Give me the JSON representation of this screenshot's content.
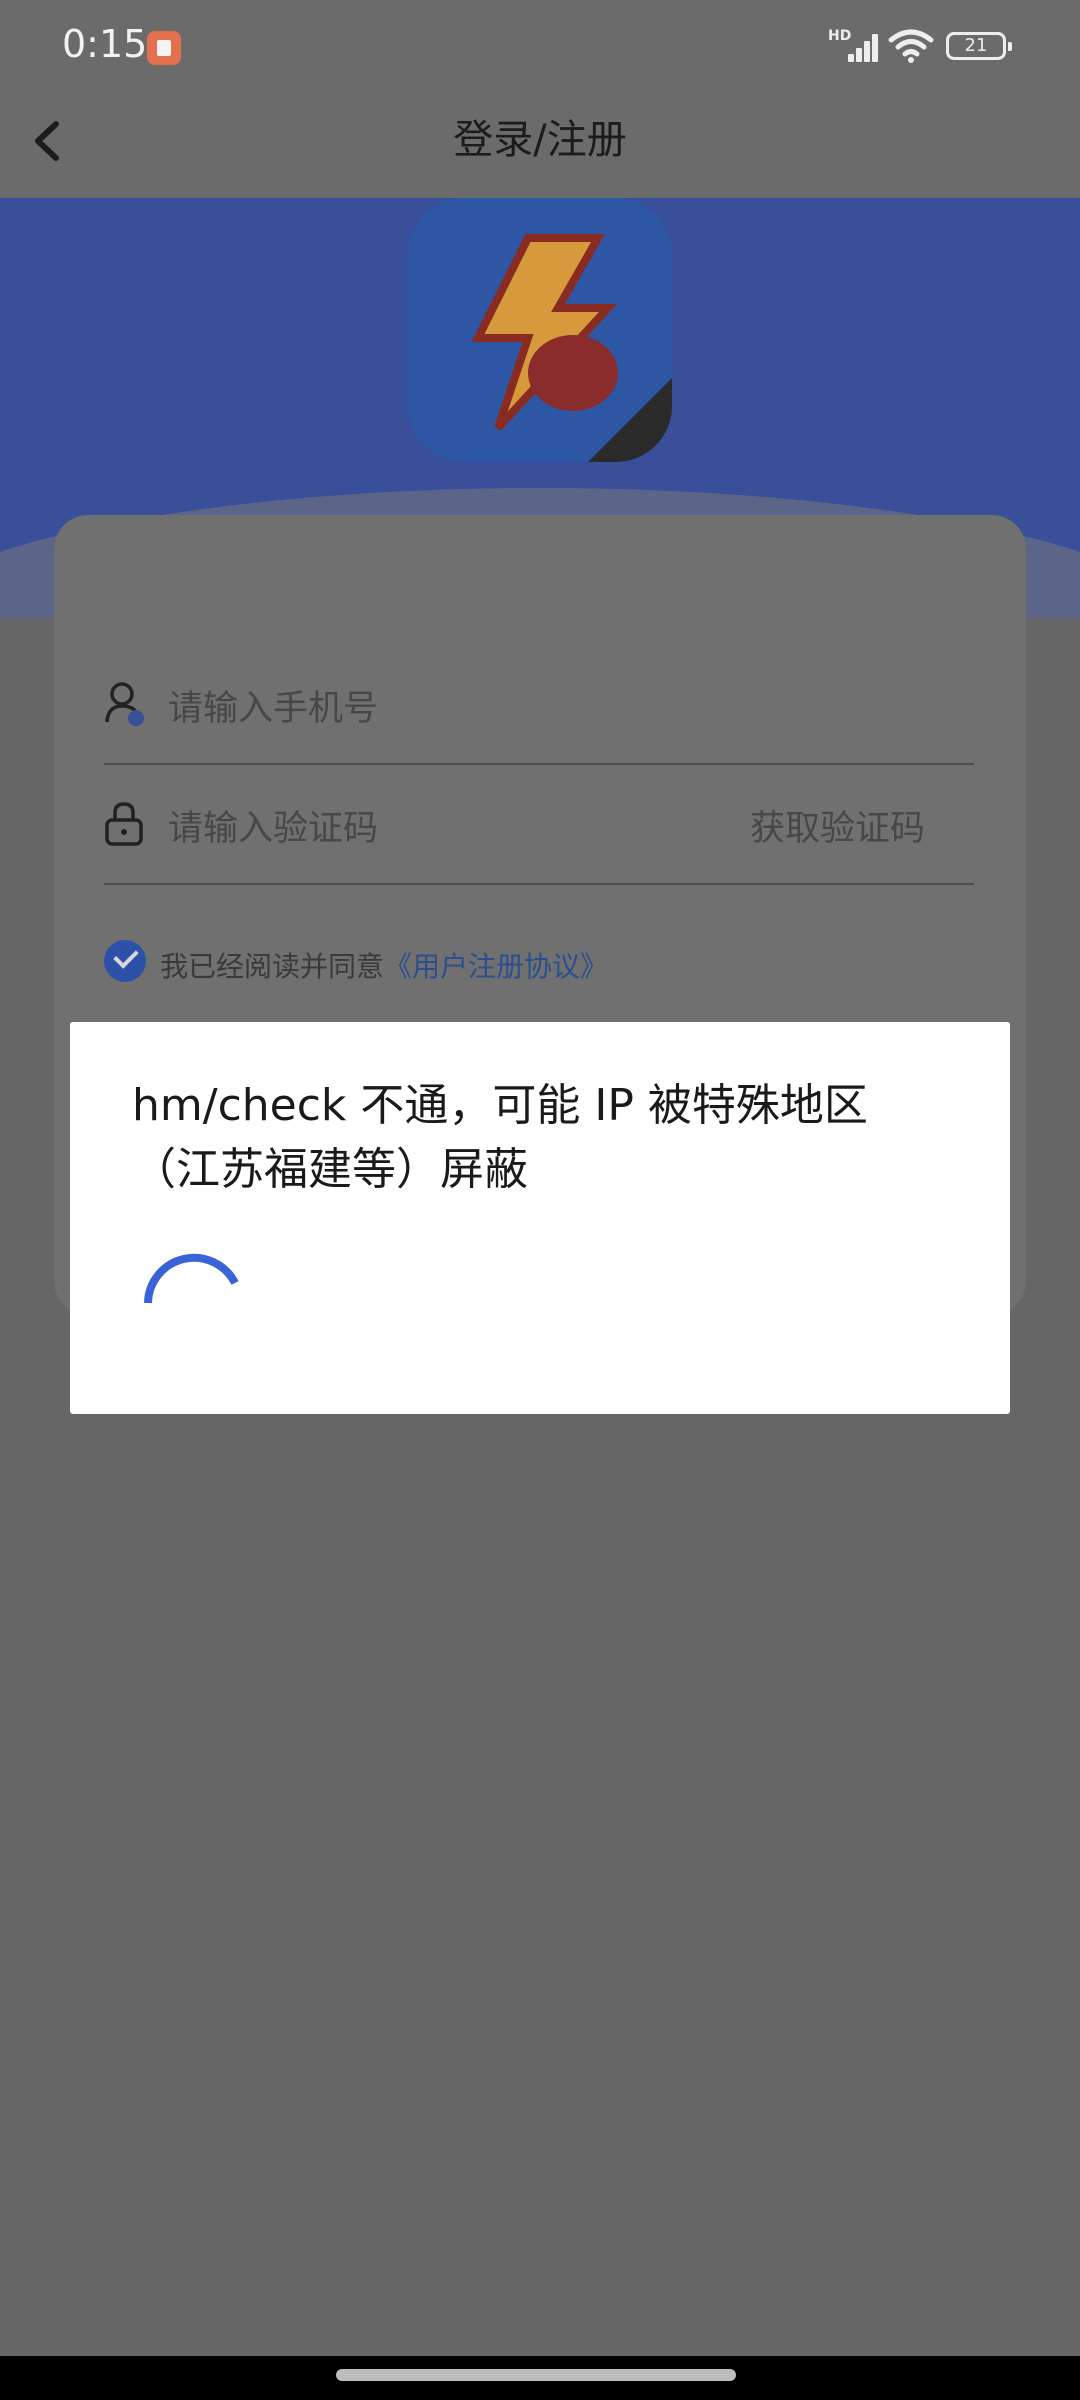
{
  "status_bar": {
    "time": "0:15",
    "network_badge": "HD",
    "battery_level": "21",
    "icons": [
      "notification-app-icon",
      "signal-icon",
      "wifi-icon",
      "battery-icon"
    ]
  },
  "header": {
    "title": "登录/注册",
    "back_icon": "chevron-left-icon"
  },
  "form": {
    "phone_placeholder": "请输入手机号",
    "code_placeholder": "请输入验证码",
    "get_code_label": "获取验证码",
    "agreement_prefix": "我已经阅读并同意",
    "agreement_link": "《用户注册协议》",
    "agreement_checked": true
  },
  "dialog": {
    "message": "hm/check 不通，可能 IP 被特殊地区（江苏福建等）屏蔽",
    "spinner_color": "#3b63d8"
  },
  "colors": {
    "accent": "#3b63d8",
    "overlay_background": "#666666",
    "banner": "#3a4f9a"
  }
}
